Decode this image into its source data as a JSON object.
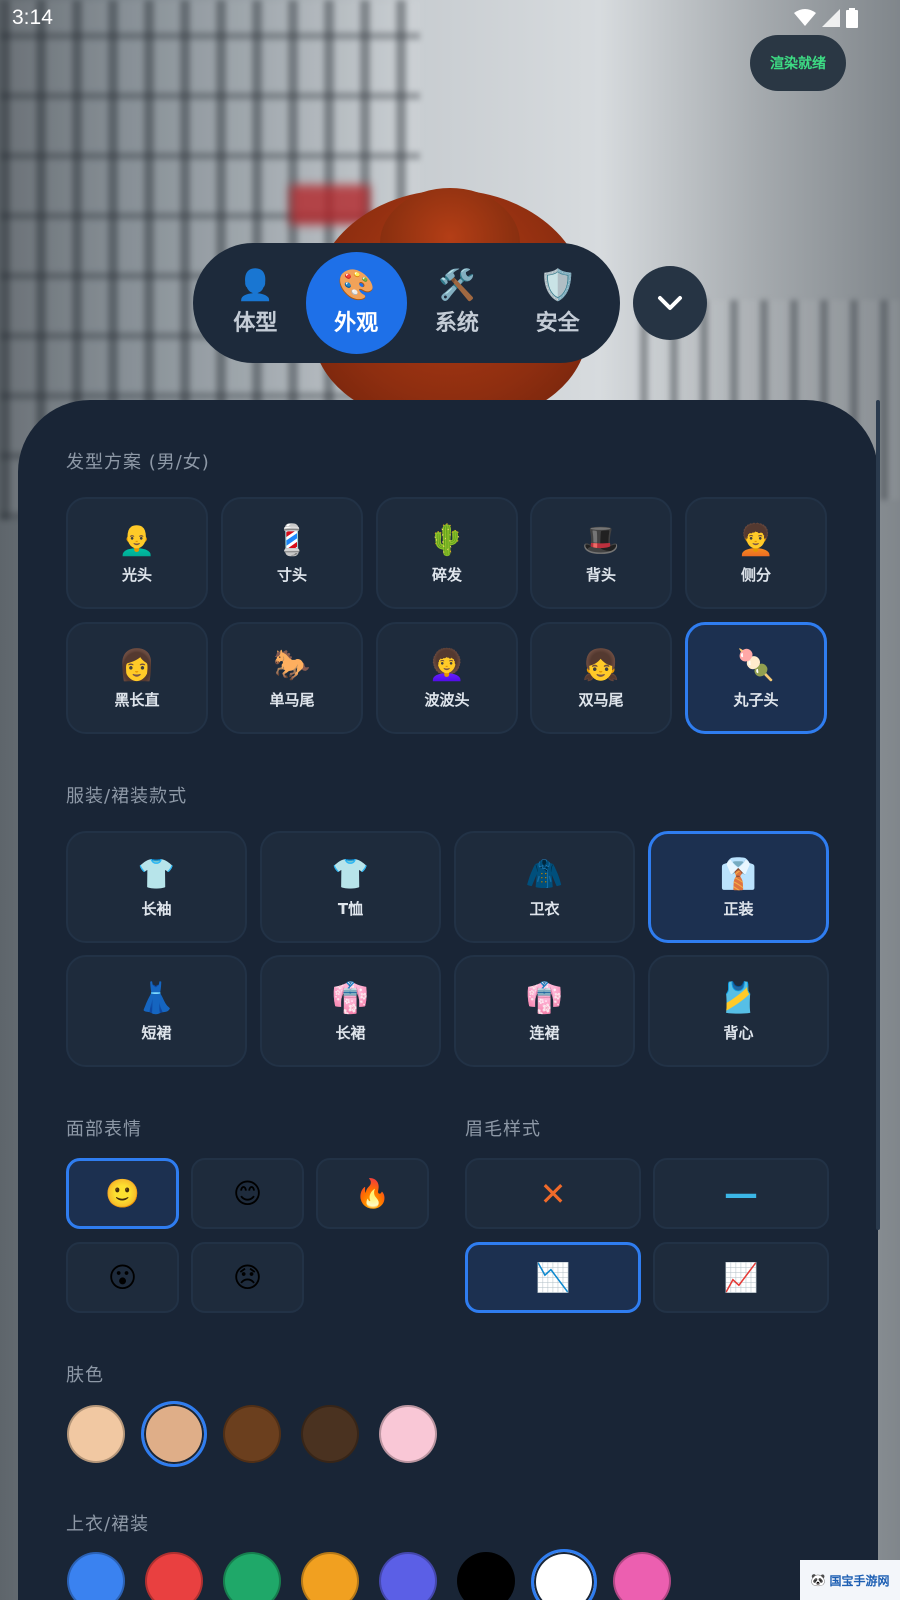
{
  "status_bar": {
    "time": "3:14"
  },
  "render_status": {
    "label": "渲染就绪",
    "color": "#3ddc84"
  },
  "nav": {
    "tabs": [
      {
        "label": "体型",
        "icon": "👤",
        "active": false
      },
      {
        "label": "外观",
        "icon": "🎨",
        "active": true
      },
      {
        "label": "系统",
        "icon": "🛠️",
        "active": false
      },
      {
        "label": "安全",
        "icon": "🛡️",
        "active": false
      }
    ],
    "collapse_icon": "chevron-down-icon",
    "accent": "#1e70e8"
  },
  "hairstyles": {
    "title": "发型方案 (男/女)",
    "items": [
      {
        "label": "光头",
        "icon": "👨‍🦲",
        "selected": false
      },
      {
        "label": "寸头",
        "icon": "💈",
        "selected": false
      },
      {
        "label": "碎发",
        "icon": "🌵",
        "selected": false
      },
      {
        "label": "背头",
        "icon": "🎩",
        "selected": false
      },
      {
        "label": "侧分",
        "icon": "🧑‍🦱",
        "selected": false
      },
      {
        "label": "黑长直",
        "icon": "👩",
        "selected": false
      },
      {
        "label": "单马尾",
        "icon": "🐎",
        "selected": false
      },
      {
        "label": "波波头",
        "icon": "👩‍🦱",
        "selected": false
      },
      {
        "label": "双马尾",
        "icon": "👧",
        "selected": false
      },
      {
        "label": "丸子头",
        "icon": "🍡",
        "selected": true
      }
    ]
  },
  "outfits": {
    "title": "服装/裙装款式",
    "items": [
      {
        "label": "长袖",
        "icon": "👕",
        "selected": false
      },
      {
        "label": "T恤",
        "icon": "👕",
        "selected": false
      },
      {
        "label": "卫衣",
        "icon": "🧥",
        "selected": false
      },
      {
        "label": "正装",
        "icon": "👔",
        "selected": true
      },
      {
        "label": "短裙",
        "icon": "👗",
        "selected": false
      },
      {
        "label": "长裙",
        "icon": "👘",
        "selected": false
      },
      {
        "label": "连裙",
        "icon": "👘",
        "selected": false
      },
      {
        "label": "背心",
        "icon": "🎽",
        "selected": false
      }
    ]
  },
  "expressions": {
    "title": "面部表情",
    "items": [
      {
        "icon": "🙂",
        "selected": true
      },
      {
        "icon": "😊",
        "selected": false
      },
      {
        "icon": "🔥",
        "selected": false
      },
      {
        "icon": "😮",
        "selected": false
      },
      {
        "icon": "😞",
        "selected": false
      }
    ]
  },
  "eyebrows": {
    "title": "眉毛样式",
    "items": [
      {
        "icon": "✕",
        "color": "#f06a2a",
        "selected": false
      },
      {
        "icon": "—",
        "color": "#3bb6e6",
        "selected": false
      },
      {
        "icon": "📉",
        "color": "#2f7df0",
        "selected": true
      },
      {
        "icon": "📈",
        "color": "#e5542e",
        "selected": false
      }
    ]
  },
  "skin_colors": {
    "title": "肤色",
    "swatches": [
      {
        "color": "#f1c8a2",
        "selected": false
      },
      {
        "color": "#dfae88",
        "selected": true
      },
      {
        "color": "#6b3f1e",
        "selected": false
      },
      {
        "color": "#4a3220",
        "selected": false
      },
      {
        "color": "#f9c7d6",
        "selected": false
      }
    ]
  },
  "top_colors": {
    "title": "上衣/裙装",
    "swatches": [
      {
        "color": "#3a82f0",
        "selected": false
      },
      {
        "color": "#e94040",
        "selected": false
      },
      {
        "color": "#1fa869",
        "selected": false
      },
      {
        "color": "#f1a020",
        "selected": false
      },
      {
        "color": "#5b5fe6",
        "selected": false
      },
      {
        "color": "#000000",
        "selected": false
      },
      {
        "color": "#ffffff",
        "selected": true
      },
      {
        "color": "#ec5fb0",
        "selected": false
      }
    ]
  },
  "watermark": {
    "text": "国宝手游网"
  }
}
